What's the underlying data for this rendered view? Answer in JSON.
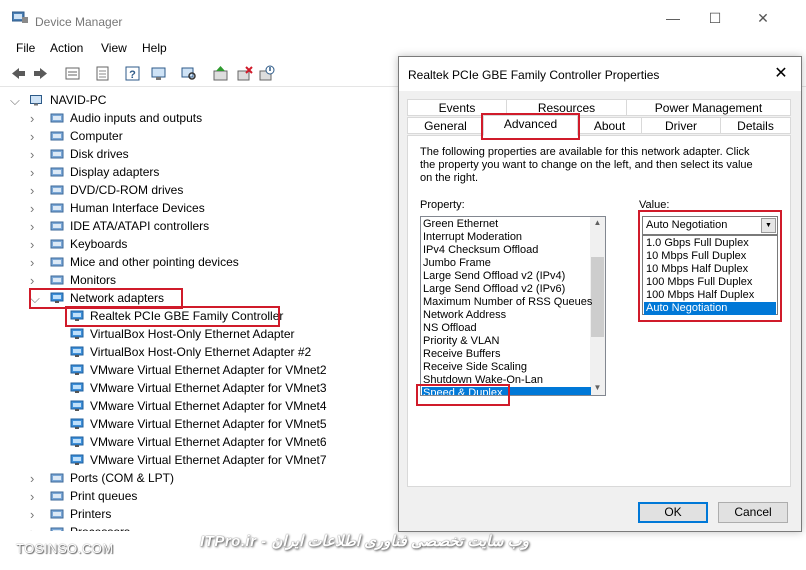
{
  "window": {
    "title": "Device Manager",
    "controls": {
      "minimize": "—",
      "maximize": "☐",
      "close": "✕"
    }
  },
  "menu": [
    "File",
    "Action",
    "View",
    "Help"
  ],
  "toolbar": [
    "back-icon",
    "forward-icon",
    "show-hidden-icon",
    "properties-icon",
    "help-icon",
    "computer-icon",
    "scan-hardware-icon",
    "update-driver-icon",
    "uninstall-icon",
    "disable-icon"
  ],
  "tree": {
    "root": "NAVID-PC",
    "categories": [
      {
        "label": "Audio inputs and outputs",
        "icon": "speaker-icon"
      },
      {
        "label": "Computer",
        "icon": "computer-icon"
      },
      {
        "label": "Disk drives",
        "icon": "disk-drive-icon"
      },
      {
        "label": "Display adapters",
        "icon": "display-adapter-icon"
      },
      {
        "label": "DVD/CD-ROM drives",
        "icon": "dvd-icon"
      },
      {
        "label": "Human Interface Devices",
        "icon": "hid-icon"
      },
      {
        "label": "IDE ATA/ATAPI controllers",
        "icon": "ide-icon"
      },
      {
        "label": "Keyboards",
        "icon": "keyboard-icon"
      },
      {
        "label": "Mice and other pointing devices",
        "icon": "mouse-icon"
      },
      {
        "label": "Monitors",
        "icon": "monitor-icon"
      }
    ],
    "network": {
      "label": "Network adapters",
      "children": [
        "Realtek PCIe GBE Family Controller",
        "VirtualBox Host-Only Ethernet Adapter",
        "VirtualBox Host-Only Ethernet Adapter #2",
        "VMware Virtual Ethernet Adapter for VMnet2",
        "VMware Virtual Ethernet Adapter for VMnet3",
        "VMware Virtual Ethernet Adapter for VMnet4",
        "VMware Virtual Ethernet Adapter for VMnet5",
        "VMware Virtual Ethernet Adapter for VMnet6",
        "VMware Virtual Ethernet Adapter for VMnet7"
      ]
    },
    "after": [
      {
        "label": "Ports (COM & LPT)",
        "icon": "port-icon"
      },
      {
        "label": "Print queues",
        "icon": "print-queue-icon"
      },
      {
        "label": "Printers",
        "icon": "printer-icon"
      },
      {
        "label": "Processors",
        "icon": "processor-icon"
      }
    ]
  },
  "watermark": {
    "left": "TOSINSO.COM",
    "right": "ITPro.ir - وب سایت تخصصی فناوری اطلاعات ایران"
  },
  "dialog": {
    "title": "Realtek PCIe GBE Family Controller Properties",
    "close": "✕",
    "tabs_top": [
      "Events",
      "Resources",
      "Power Management"
    ],
    "tabs_bottom": [
      "General",
      "Advanced",
      "About",
      "Driver",
      "Details"
    ],
    "active_tab": "Advanced",
    "description": "The following properties are available for this network adapter. Click the property you want to change on the left, and then select its value on the right.",
    "property_label": "Property:",
    "value_label": "Value:",
    "properties": [
      "Green Ethernet",
      "Interrupt Moderation",
      "IPv4 Checksum Offload",
      "Jumbo Frame",
      "Large Send Offload v2 (IPv4)",
      "Large Send Offload v2 (IPv6)",
      "Maximum Number of RSS Queues",
      "Network Address",
      "NS Offload",
      "Priority & VLAN",
      "Receive Buffers",
      "Receive Side Scaling",
      "Shutdown Wake-On-Lan",
      "Speed & Duplex"
    ],
    "selected_property": "Speed & Duplex",
    "value_selected": "Auto Negotiation",
    "value_options": [
      "1.0 Gbps Full Duplex",
      "10 Mbps Full Duplex",
      "10 Mbps Half Duplex",
      "100 Mbps Full Duplex",
      "100 Mbps Half Duplex",
      "Auto Negotiation"
    ],
    "ok": "OK",
    "cancel": "Cancel"
  },
  "colors": {
    "highlight_box": "#d01b2a",
    "selection": "#0078d7"
  }
}
